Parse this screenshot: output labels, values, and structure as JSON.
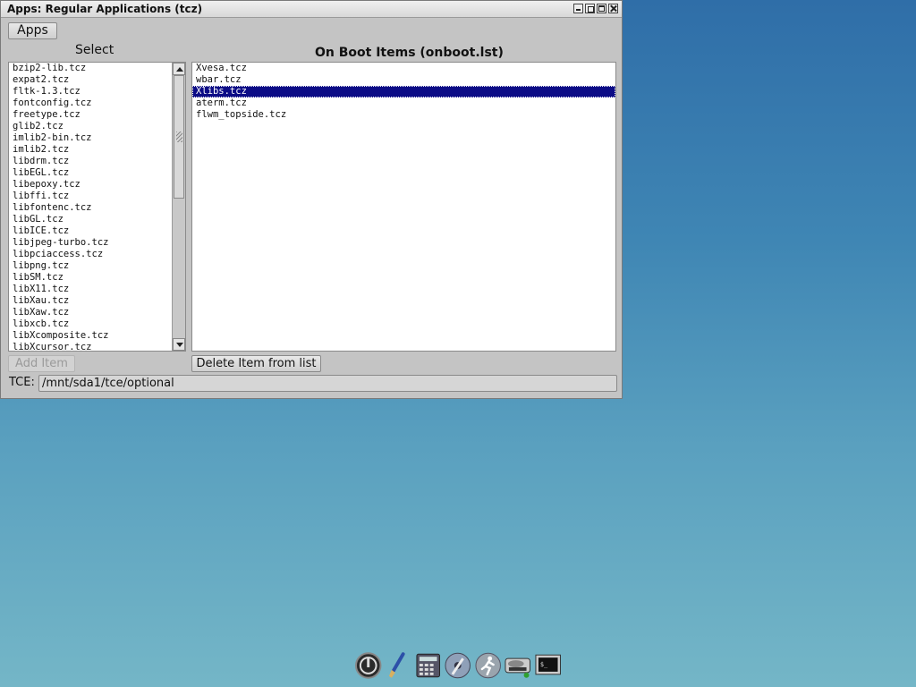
{
  "window": {
    "title": "Apps: Regular Applications (tcz)",
    "controls": [
      "minimize",
      "restore",
      "maximize",
      "close"
    ]
  },
  "menu": {
    "apps_label": "Apps"
  },
  "left_panel": {
    "heading": "Select",
    "items": [
      "bzip2-lib.tcz",
      "expat2.tcz",
      "fltk-1.3.tcz",
      "fontconfig.tcz",
      "freetype.tcz",
      "glib2.tcz",
      "imlib2-bin.tcz",
      "imlib2.tcz",
      "libdrm.tcz",
      "libEGL.tcz",
      "libepoxy.tcz",
      "libffi.tcz",
      "libfontenc.tcz",
      "libGL.tcz",
      "libICE.tcz",
      "libjpeg-turbo.tcz",
      "libpciaccess.tcz",
      "libpng.tcz",
      "libSM.tcz",
      "libX11.tcz",
      "libXau.tcz",
      "libXaw.tcz",
      "libxcb.tcz",
      "libXcomposite.tcz",
      "libXcursor.tcz"
    ],
    "add_button": "Add Item"
  },
  "right_panel": {
    "heading": "On Boot Items (onboot.lst)",
    "items": [
      "Xvesa.tcz",
      "wbar.tcz",
      "Xlibs.tcz",
      "aterm.tcz",
      "flwm_topside.tcz"
    ],
    "selected_index": 2,
    "delete_button": "Delete Item from list"
  },
  "tce": {
    "label": "TCE:",
    "path": "/mnt/sda1/tce/optional"
  },
  "dock": {
    "icons": [
      "power-icon",
      "paintbrush-icon",
      "calculator-icon",
      "disk-icon",
      "runner-icon",
      "hdd-icon",
      "terminal-icon"
    ]
  },
  "colors": {
    "selection": "#0c0c86",
    "window_bg": "#c4c4c4",
    "desktop_top": "#2f6ea8",
    "desktop_bottom": "#74b6c7"
  }
}
